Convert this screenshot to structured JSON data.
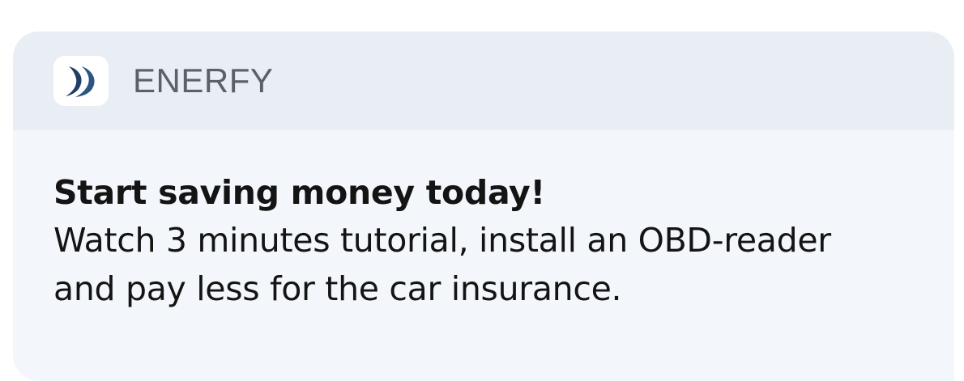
{
  "notification": {
    "app_name": "ENERFY",
    "app_icon": "enerfy-logo-icon",
    "title": "Start saving money today!",
    "message": "Watch 3 minutes tutorial, install an OBD-reader and pay less for the car insurance."
  },
  "colors": {
    "header_bg": "#e9eef5",
    "body_bg": "#f3f6fa",
    "logo_blue": "#1f3f66"
  }
}
